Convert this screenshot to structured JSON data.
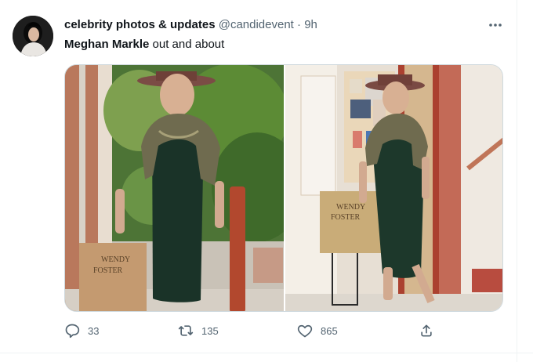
{
  "tweet": {
    "display_name": "celebrity photos & updates",
    "handle": "@candidevent",
    "dot": "·",
    "time": "9h",
    "text_bold": "Meghan Markle",
    "text_rest": " out and about",
    "media": {
      "count": 2
    },
    "actions": {
      "replies": "33",
      "retweets": "135",
      "likes": "865"
    }
  },
  "icons": {
    "more": "more-horizontal-icon",
    "reply": "reply-icon",
    "retweet": "retweet-icon",
    "like": "like-icon",
    "share": "share-icon"
  },
  "colors": {
    "text_primary": "#0f1419",
    "text_secondary": "#536471",
    "border": "#cfd9de"
  }
}
